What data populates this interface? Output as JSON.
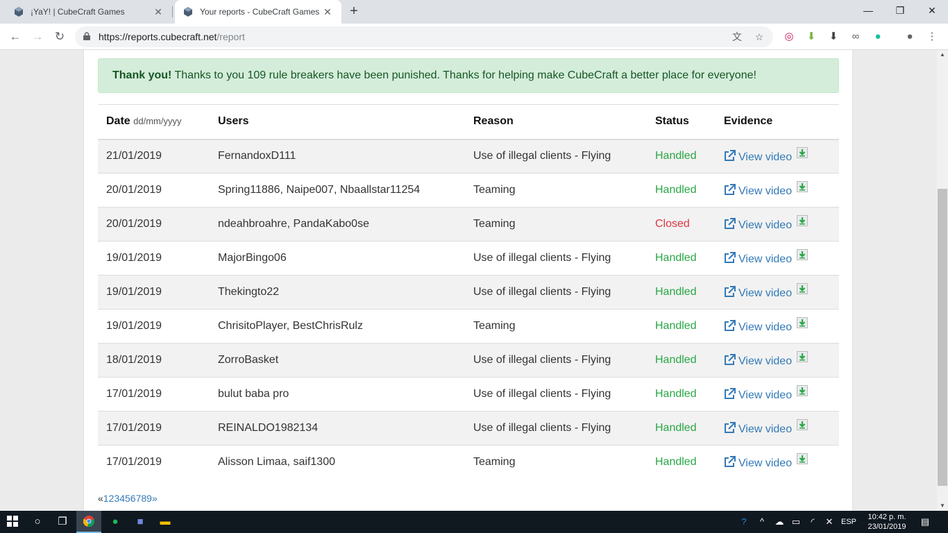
{
  "browser": {
    "tabs": [
      {
        "title": "¡YaY! | CubeCraft Games",
        "active": false
      },
      {
        "title": "Your reports - CubeCraft Games",
        "active": true
      }
    ],
    "url_domain": "https://reports.cubecraft.net",
    "url_path": "/report",
    "window_controls": {
      "minimize": "—",
      "maximize": "❐",
      "close": "✕"
    },
    "nav": {
      "back": "←",
      "forward": "→",
      "reload": "↻",
      "new_tab": "+"
    },
    "menu": "⋮"
  },
  "alert": {
    "strong": "Thank you!",
    "text": " Thanks to you 109 rule breakers have been punished. Thanks for helping make CubeCraft a better place for everyone!"
  },
  "table": {
    "headers": {
      "date": "Date",
      "date_hint": "dd/mm/yyyy",
      "users": "Users",
      "reason": "Reason",
      "status": "Status",
      "evidence": "Evidence"
    },
    "link_label": "View video",
    "rows": [
      {
        "date": "21/01/2019",
        "users": "FernandoxD111",
        "reason": "Use of illegal clients - Flying",
        "status": "Handled"
      },
      {
        "date": "20/01/2019",
        "users": "Spring11886, Naipe007, Nbaallstar11254",
        "reason": "Teaming",
        "status": "Handled"
      },
      {
        "date": "20/01/2019",
        "users": "ndeahbroahre, PandaKabo0se",
        "reason": "Teaming",
        "status": "Closed"
      },
      {
        "date": "19/01/2019",
        "users": "MajorBingo06",
        "reason": "Use of illegal clients - Flying",
        "status": "Handled"
      },
      {
        "date": "19/01/2019",
        "users": "Thekingto22",
        "reason": "Use of illegal clients - Flying",
        "status": "Handled"
      },
      {
        "date": "19/01/2019",
        "users": "ChrisitoPlayer, BestChrisRulz",
        "reason": "Teaming",
        "status": "Handled"
      },
      {
        "date": "18/01/2019",
        "users": "ZorroBasket",
        "reason": "Use of illegal clients - Flying",
        "status": "Handled"
      },
      {
        "date": "17/01/2019",
        "users": "bulut baba pro",
        "reason": "Use of illegal clients - Flying",
        "status": "Handled"
      },
      {
        "date": "17/01/2019",
        "users": "REINALDO1982134",
        "reason": "Use of illegal clients - Flying",
        "status": "Handled"
      },
      {
        "date": "17/01/2019",
        "users": "Alisson Limaa, saif1300",
        "reason": "Teaming",
        "status": "Handled"
      }
    ]
  },
  "pagination": {
    "prev": "«",
    "pages": [
      "1",
      "2",
      "3",
      "4",
      "5",
      "6",
      "7",
      "8",
      "9"
    ],
    "next": "»"
  },
  "taskbar": {
    "language": "ESP",
    "time": "10:42 p. m.",
    "date": "23/01/2019"
  },
  "colors": {
    "handled": "#28a745",
    "closed": "#dc3545",
    "link": "#337ab7",
    "alert_bg": "#d4edda"
  }
}
